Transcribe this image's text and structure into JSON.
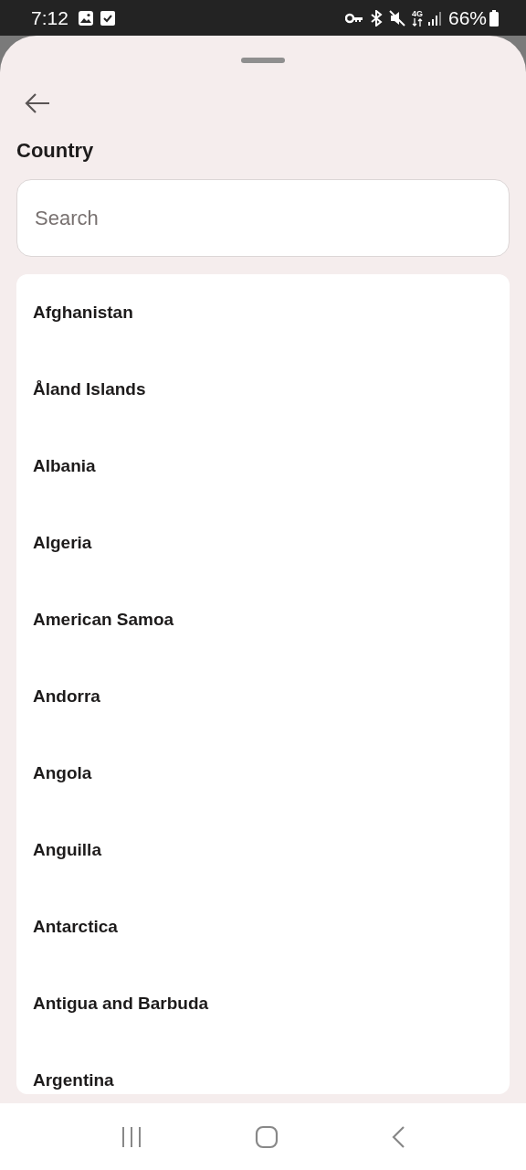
{
  "status_bar": {
    "time": "7:12",
    "network": "4G",
    "battery": "66%"
  },
  "title": "Country",
  "search": {
    "placeholder": "Search"
  },
  "countries": [
    "Afghanistan",
    "Åland Islands",
    "Albania",
    "Algeria",
    "American Samoa",
    "Andorra",
    "Angola",
    "Anguilla",
    "Antarctica",
    "Antigua and Barbuda",
    "Argentina"
  ]
}
